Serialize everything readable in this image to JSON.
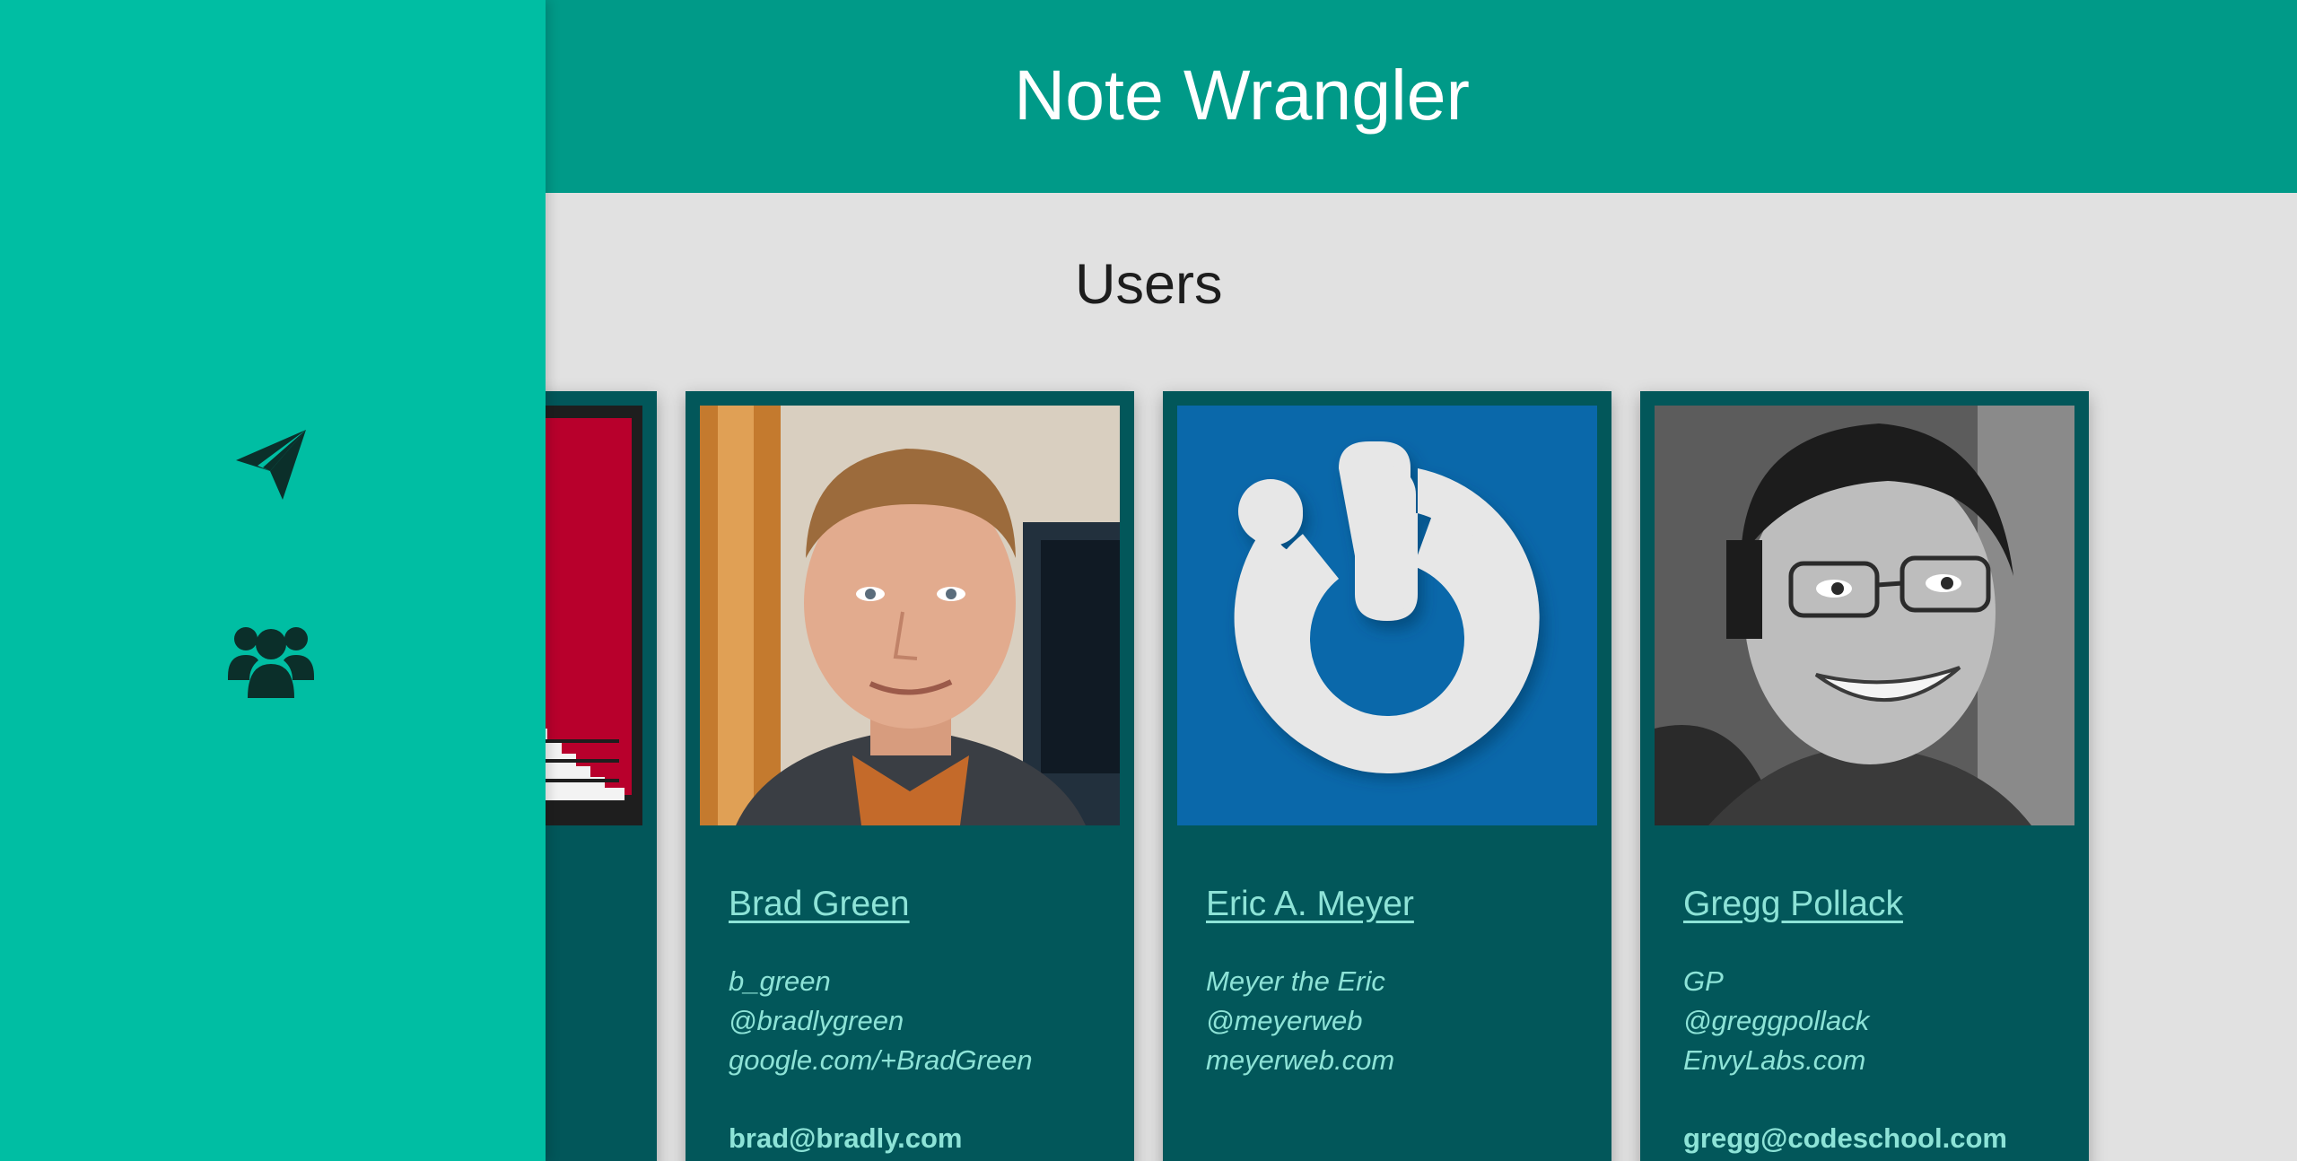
{
  "header": {
    "title": "Note Wrangler"
  },
  "page": {
    "title": "Users"
  },
  "sidebar": {
    "items": [
      {
        "icon": "paper-plane-icon"
      },
      {
        "icon": "users-icon"
      }
    ]
  },
  "users": [
    {
      "name": "Brad Green",
      "alias": "b_green",
      "twitter": "@bradlygreen",
      "website": "google.com/+BradGreen",
      "email": "brad@bradly.com"
    },
    {
      "name": "Eric A. Meyer",
      "alias": "Meyer the Eric",
      "twitter": "@meyerweb",
      "website": "meyerweb.com",
      "email": ""
    },
    {
      "name": "Gregg Pollack",
      "alias": "GP",
      "twitter": "@greggpollack",
      "website": "EnvyLabs.com",
      "email": "gregg@codeschool.com"
    }
  ],
  "colors": {
    "header": "#009a88",
    "sidebar": "#00bea3",
    "card": "#02575a",
    "link": "#8de3d7",
    "background": "#e1e1e1"
  }
}
